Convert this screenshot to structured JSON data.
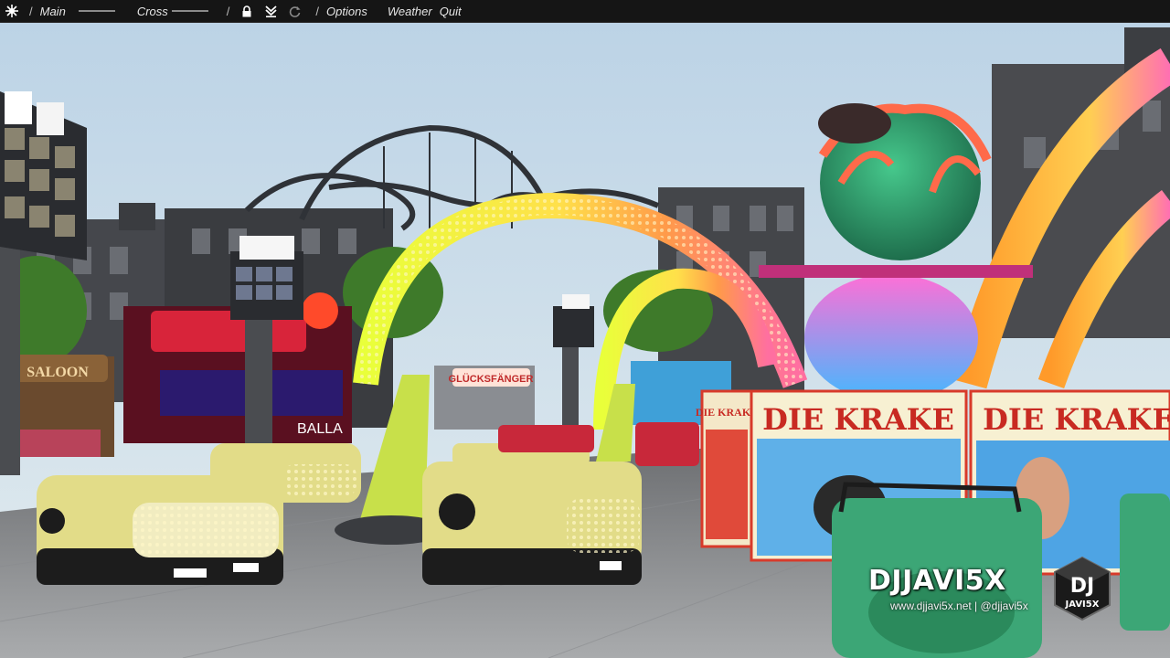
{
  "menu": {
    "main_label": "Main",
    "cross_label": "Cross",
    "options_label": "Options",
    "weather_label": "Weather",
    "quit_label": "Quit",
    "separator": "/"
  },
  "icons": {
    "app": "starburst-icon",
    "lock": "lock-icon",
    "download": "download-icon",
    "reset": "rotate-icon"
  },
  "scene": {
    "ride_sign_1": "DIE KRAKE",
    "ride_sign_2": "DIE KRAKE",
    "ride_sign_side": "DIE KRAKE",
    "saloon_sign": "SALOON",
    "stall_sign": "GLÜCKSFÄNGER",
    "booth_sign": "BALLA"
  },
  "watermark": {
    "title": "DJJAVI5X",
    "subtitle": "www.djjavi5x.net | @djjavi5x",
    "logo_top": "DJ",
    "logo_bottom": "JAVI5X"
  },
  "colors": {
    "sky": "#cfe0ee",
    "menubar": "#151515",
    "arch_yellow": "#d8f04a",
    "arch_orange": "#ff8a3a",
    "car_yellow": "#e4dd86",
    "car_green": "#3fae7a",
    "octopus": "#2f9b6c"
  }
}
